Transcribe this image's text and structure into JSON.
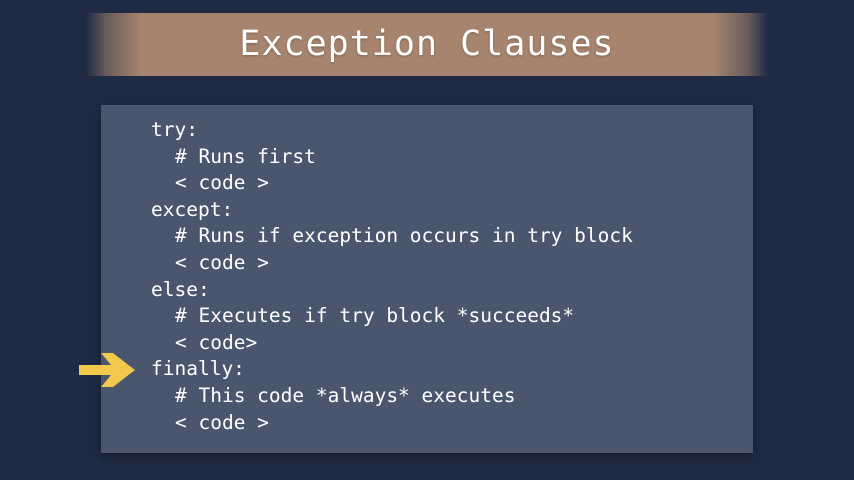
{
  "slide": {
    "title": "Exception Clauses",
    "code_lines": [
      {
        "text": "try:",
        "indent": false
      },
      {
        "text": "# Runs first",
        "indent": true
      },
      {
        "text": "< code >",
        "indent": true
      },
      {
        "text": "except:",
        "indent": false
      },
      {
        "text": "# Runs if exception occurs in try block",
        "indent": true
      },
      {
        "text": "< code >",
        "indent": true
      },
      {
        "text": "else:",
        "indent": false
      },
      {
        "text": "# Executes if try block *succeeds*",
        "indent": true
      },
      {
        "text": "< code>",
        "indent": true
      },
      {
        "text": "finally:",
        "indent": false
      },
      {
        "text": "# This code *always* executes",
        "indent": true
      },
      {
        "text": "< code >",
        "indent": true
      }
    ],
    "highlighted_line": "finally:",
    "pointer_icon": "right-arrow-icon"
  },
  "colors": {
    "background": "#1f2b44",
    "title_banner": "#a6846e",
    "code_panel": "#4a566d",
    "text": "#ffffff",
    "arrow": "#f2c94c"
  }
}
